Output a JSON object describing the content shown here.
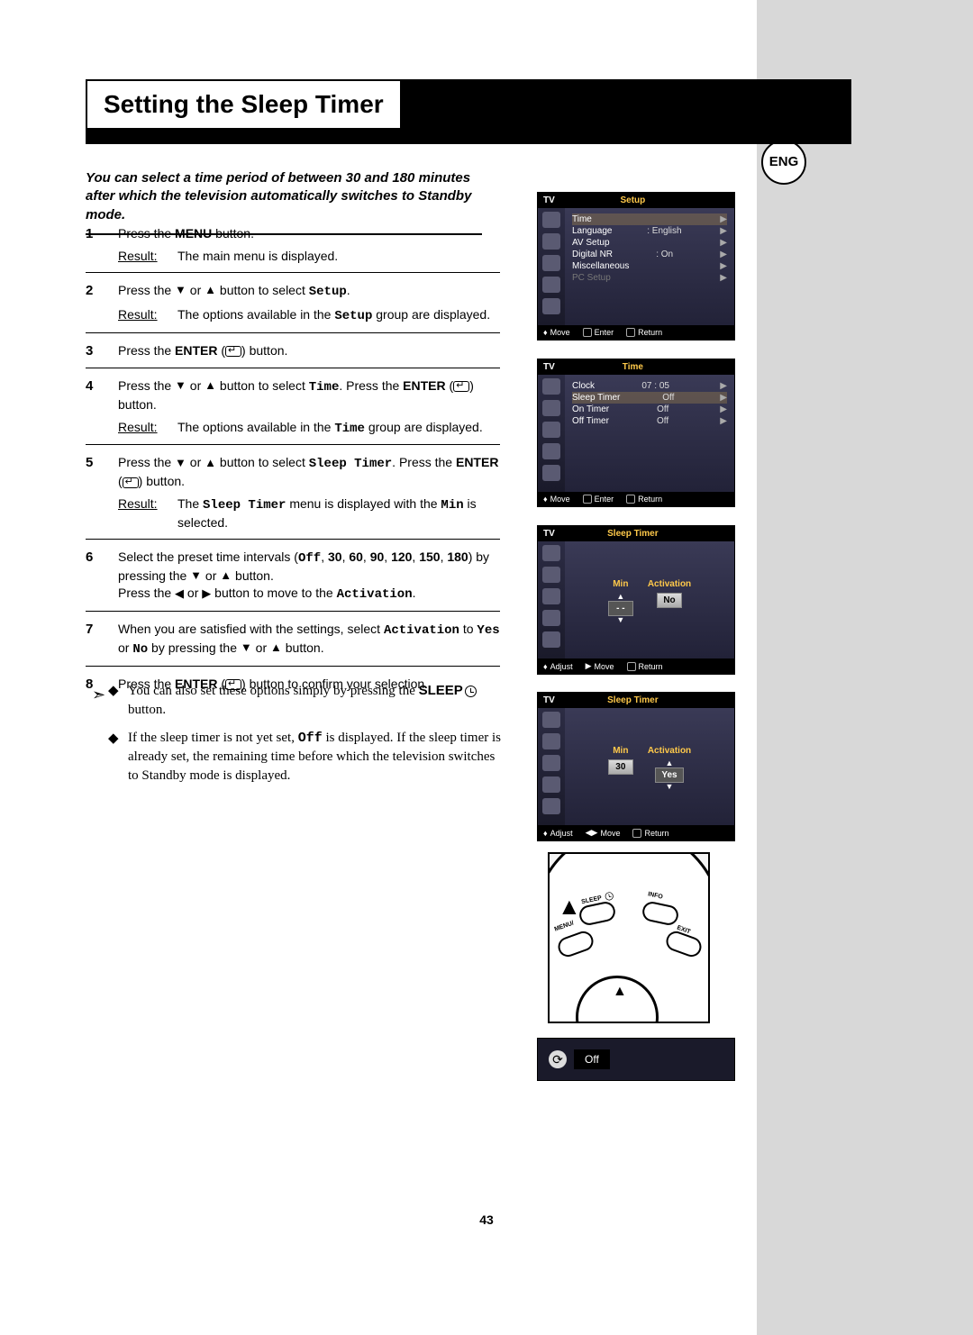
{
  "lang_badge": "ENG",
  "title": "Setting the Sleep Timer",
  "intro": "You can select a time period of between 30 and 180 minutes after which the television automatically switches to Standby mode.",
  "steps": {
    "s1": {
      "num": "1",
      "line1a": "Press the ",
      "line1b": "MENU",
      "line1c": " button.",
      "result_label": "Result:",
      "result": "The main menu is displayed."
    },
    "s2": {
      "num": "2",
      "line_a": "Press the ",
      "line_b": " or ",
      "line_c": " button to select ",
      "line_mono": "Setup",
      "line_d": ".",
      "result_label": "Result:",
      "result_a": "The options available in the ",
      "result_mono": "Setup",
      "result_b": " group are displayed."
    },
    "s3": {
      "num": "3",
      "line_a": "Press the ",
      "line_b": "ENTER",
      "line_c": " (",
      "line_d": ") button."
    },
    "s4": {
      "num": "4",
      "line_a": "Press the ",
      "line_b": " or ",
      "line_c": " button to select ",
      "line_mono1": "Time",
      "line_d": ". Press the ",
      "line_e": "ENTER",
      "line_f": " (",
      "line_g": ") button.",
      "result_label": "Result:",
      "result_a": "The options available in the ",
      "result_mono": "Time",
      "result_b": " group are displayed."
    },
    "s5": {
      "num": "5",
      "line_a": "Press the ",
      "line_b": " or ",
      "line_c": " button to select ",
      "line_mono": "Sleep Timer",
      "line_d": ". Press the ",
      "line_e": "ENTER",
      "line_f": " (",
      "line_g": ") button.",
      "result_label": "Result:",
      "result_x": "The ",
      "result_mono1": "Sleep Timer",
      "result_y": " menu is displayed with the ",
      "result_mono2": "Min",
      "result_z": " is selected."
    },
    "s6": {
      "num": "6",
      "line_a": "Select the preset time intervals (",
      "line_mono": "Off",
      "line_b": ", ",
      "v30": "30",
      "v60": "60",
      "v90": "90",
      "v120": "120",
      "v150": "150",
      "v180": "180",
      "line_c": ") by pressing the ",
      "line_d": " or ",
      "line_e": " button.",
      "line_f": "Press the ",
      "line_g": " or ",
      "line_h": " button to move to the ",
      "line_mono2": "Activation",
      "line_i": "."
    },
    "s7": {
      "num": "7",
      "line_a": "When you are satisfied with the settings, select ",
      "line_mono1": "Activation",
      "line_b": " to ",
      "line_mono2": "Yes",
      "line_c": " or ",
      "line_mono3": "No",
      "line_d": " by pressing the ",
      "line_e": " or ",
      "line_f": " button."
    },
    "s8": {
      "num": "8",
      "line_a": "Press the ",
      "line_b": "ENTER",
      "line_c": " (",
      "line_d": ") button to confirm your selection."
    }
  },
  "notes": {
    "n1_a": "You can also set these options simply by pressing the ",
    "n1_bold": "SLEEP",
    "n1_b": " button.",
    "n2_a": "If the sleep timer is not yet set, ",
    "n2_mono": "Off",
    "n2_b": " is displayed. If the sleep timer is already set, the remaining time before which the television switches to Standby mode is displayed."
  },
  "osd1": {
    "tv": "TV",
    "title": "Setup",
    "items": [
      {
        "label": "Time",
        "val": "",
        "arrow": true,
        "sel": true
      },
      {
        "label": "Language",
        "val": ": English",
        "arrow": true
      },
      {
        "label": "AV Setup",
        "val": "",
        "arrow": true
      },
      {
        "label": "Digital NR",
        "val": ": On",
        "arrow": true
      },
      {
        "label": "Miscellaneous",
        "val": "",
        "arrow": true
      },
      {
        "label": "PC Setup",
        "val": "",
        "arrow": true,
        "dim": true
      }
    ],
    "foot": {
      "a": "Move",
      "b": "Enter",
      "c": "Return"
    }
  },
  "osd2": {
    "tv": "TV",
    "title": "Time",
    "items": [
      {
        "label": "Clock",
        "val": "07 : 05",
        "arrow": true
      },
      {
        "label": "Sleep Timer",
        "val": "Off",
        "arrow": true,
        "sel": true
      },
      {
        "label": "On Timer",
        "val": "Off",
        "arrow": true
      },
      {
        "label": "Off Timer",
        "val": "Off",
        "arrow": true
      }
    ],
    "foot": {
      "a": "Move",
      "b": "Enter",
      "c": "Return"
    }
  },
  "osd3": {
    "tv": "TV",
    "title": "Sleep Timer",
    "min_label": "Min",
    "act_label": "Activation",
    "min_val": "- -",
    "act_val": "No",
    "foot": {
      "a": "Adjust",
      "b": "Move",
      "c": "Return"
    }
  },
  "osd4": {
    "tv": "TV",
    "title": "Sleep Timer",
    "min_label": "Min",
    "act_label": "Activation",
    "min_val": "30",
    "act_val": "Yes",
    "foot": {
      "a": "Adjust",
      "b": "Move",
      "c": "Return"
    }
  },
  "remote": {
    "sleep": "SLEEP",
    "info": "INFO",
    "menu": "MENU/",
    "exit": "EXIT"
  },
  "osd_off": {
    "value": "Off"
  },
  "page_number": "43"
}
